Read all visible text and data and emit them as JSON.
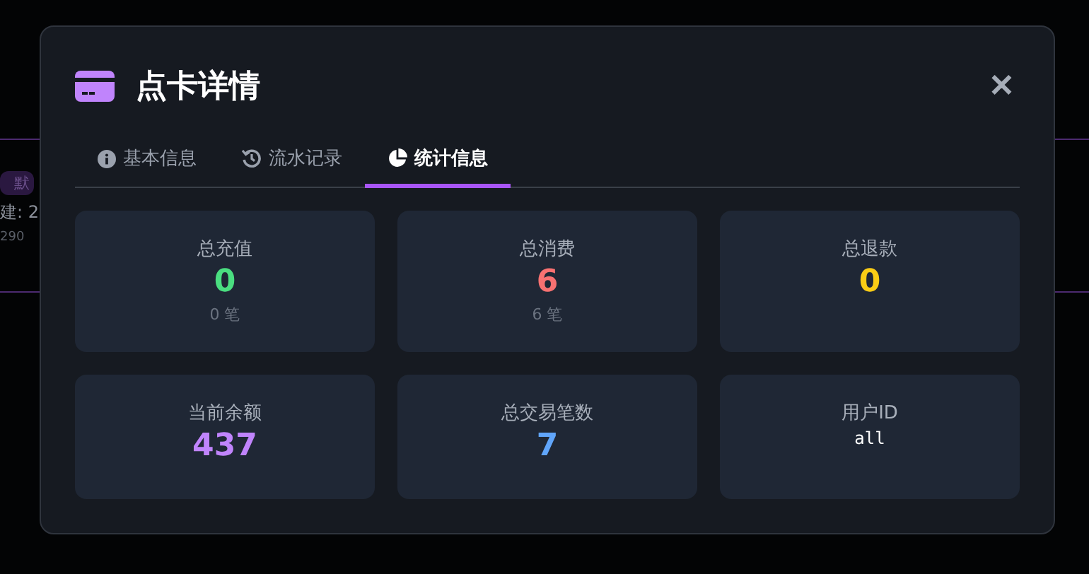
{
  "background": {
    "badge": "默",
    "created": "建: 2",
    "code": "290"
  },
  "dialog": {
    "title": "点卡详情",
    "close": "✕",
    "tabs": [
      {
        "label": "基本信息",
        "selected": false
      },
      {
        "label": "流水记录",
        "selected": false
      },
      {
        "label": "统计信息",
        "selected": true
      }
    ],
    "stats": [
      {
        "label": "总充值",
        "value": "0",
        "color": "#4ade80",
        "sub": "0 笔"
      },
      {
        "label": "总消费",
        "value": "6",
        "color": "#f87171",
        "sub": "6 笔"
      },
      {
        "label": "总退款",
        "value": "0",
        "color": "#facc15"
      },
      {
        "label": "当前余额",
        "value": "437",
        "color": "#c084fc"
      },
      {
        "label": "总交易笔数",
        "value": "7",
        "color": "#60a5fa"
      },
      {
        "label": "用户ID",
        "value": "all",
        "kind": "code"
      }
    ]
  }
}
